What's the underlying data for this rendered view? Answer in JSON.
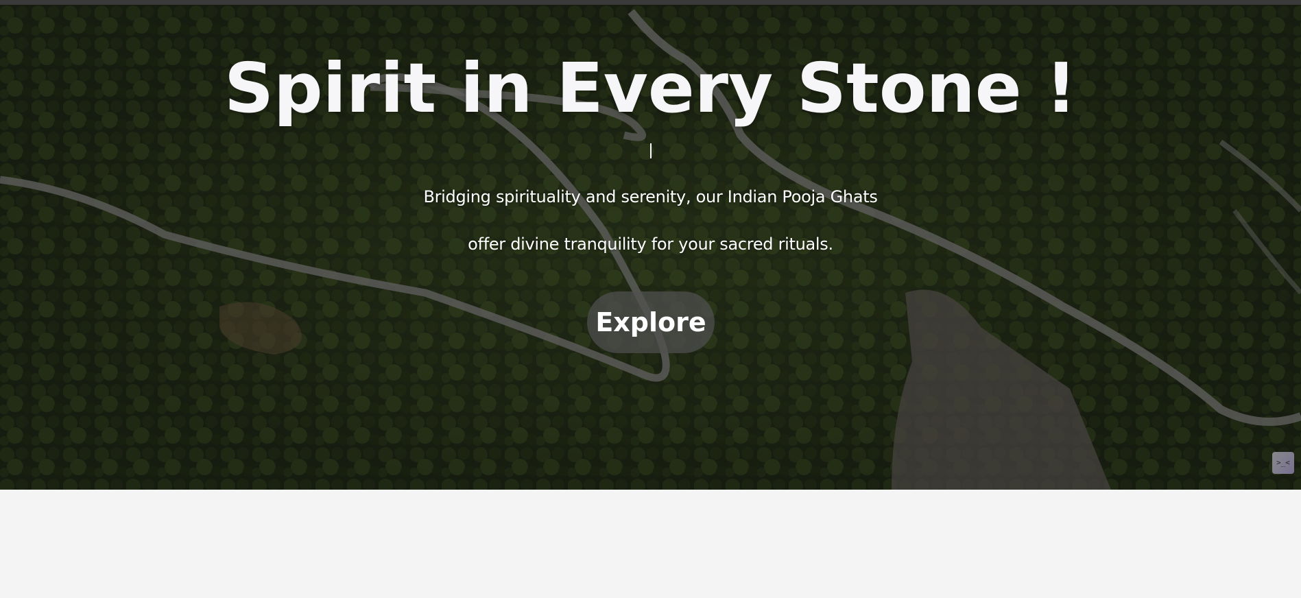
{
  "hero": {
    "title": "Spirit in Every Stone !",
    "subtitle_line1": "Bridging spirituality and serenity, our Indian Pooja Ghats",
    "subtitle_line2": "offer divine tranquility for your sacred rituals.",
    "explore_label": "Explore",
    "cursor_glyph": "|"
  },
  "widget": {
    "glyph": ">_<",
    "icon": "chat-widget-icon"
  },
  "colors": {
    "title": "#f6f6f8",
    "button_bg": "#505050",
    "page_bg": "#f4f4f4",
    "top_strip": "#3a3a3a"
  }
}
